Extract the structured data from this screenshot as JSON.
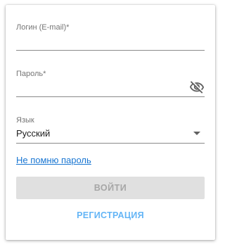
{
  "form": {
    "login": {
      "label": "Логин (E-mail)*",
      "value": "",
      "placeholder": ""
    },
    "password": {
      "label": "Пароль*",
      "value": "",
      "placeholder": "",
      "toggle_icon": "eye-off-icon"
    },
    "language": {
      "label": "Язык",
      "selected": "Русский",
      "arrow_icon": "caret-down-icon"
    },
    "forgot_link": "Не помню пароль",
    "login_button": "ВОЙТИ",
    "register_button": "РЕГИСТРАЦИЯ"
  },
  "colors": {
    "link": "#1976d2",
    "register": "#64b5f6",
    "button_disabled_bg": "#e0e0e0",
    "button_disabled_text": "#a6a6a6",
    "label": "#757575",
    "underline": "#8a8a8a"
  }
}
